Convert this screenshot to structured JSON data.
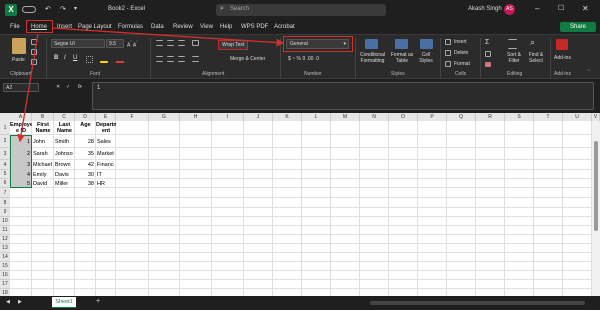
{
  "titlebar": {
    "doc_title": "Book2 - Excel",
    "search_placeholder": "Search",
    "user_name": "Akash Singh",
    "user_initials": "AS"
  },
  "menu": {
    "items": [
      "File",
      "Home",
      "Insert",
      "Page Layout",
      "Formulas",
      "Data",
      "Review",
      "View",
      "Help",
      "WPS PDF",
      "Acrobat"
    ],
    "share_label": "Share"
  },
  "ribbon": {
    "paste_label": "Paste",
    "font_name": "Segoe UI",
    "font_size": "9.5",
    "bold": "B",
    "italic": "I",
    "underline": "U",
    "wrap_text": "Wrap Text",
    "merge_center": "Merge & Center",
    "number_format": "General",
    "number_symbols": "$ ~ % 9 .00 .0",
    "cond_format": "Conditional Formatting",
    "format_table": "Format as Table",
    "cell_styles": "Cell Styles",
    "insert": "Insert",
    "delete": "Delete",
    "format": "Format",
    "sort_filter": "Sort & Filter",
    "find_select": "Find & Select",
    "addins": "Add-ins",
    "groups": {
      "clipboard": "Clipboard",
      "font": "Font",
      "alignment": "Alignment",
      "number": "Number",
      "styles": "Styles",
      "cells": "Cells",
      "editing": "Editing",
      "addins": "Add-ins"
    }
  },
  "formula_bar": {
    "name_box": "A2",
    "fx": "fx",
    "value": "1"
  },
  "columns": [
    "A",
    "B",
    "C",
    "D",
    "E",
    "F",
    "G",
    "H",
    "I",
    "J",
    "K",
    "L",
    "M",
    "N",
    "O",
    "P",
    "Q",
    "R",
    "S",
    "T",
    "U",
    "V"
  ],
  "rows": [
    "1",
    "2",
    "3",
    "4",
    "5",
    "6",
    "7",
    "8",
    "9",
    "10",
    "11",
    "12",
    "13",
    "14",
    "15",
    "16",
    "17",
    "18",
    "19",
    "20",
    "21",
    "22",
    "23",
    "24",
    "25",
    "26"
  ],
  "table": {
    "headers": [
      "Employe e ID",
      "First Name",
      "Last Name",
      "Age",
      "Departm ent"
    ],
    "rows": [
      [
        "1",
        "John",
        "Smith",
        "28",
        "Sales"
      ],
      [
        "2",
        "Sarah",
        "Johnson",
        "35",
        "Marketing"
      ],
      [
        "3",
        "Michael",
        "Brown",
        "42",
        "Finance"
      ],
      [
        "4",
        "Emily",
        "Davis",
        "30",
        "IT"
      ],
      [
        "5",
        "David",
        "Miller",
        "38",
        "HR"
      ]
    ]
  },
  "sheet_tabs": {
    "active": "Sheet1",
    "add": "+"
  },
  "colors": {
    "accent": "#d32f2f",
    "excel_green": "#107c41",
    "selection": "#b5b5b5"
  }
}
